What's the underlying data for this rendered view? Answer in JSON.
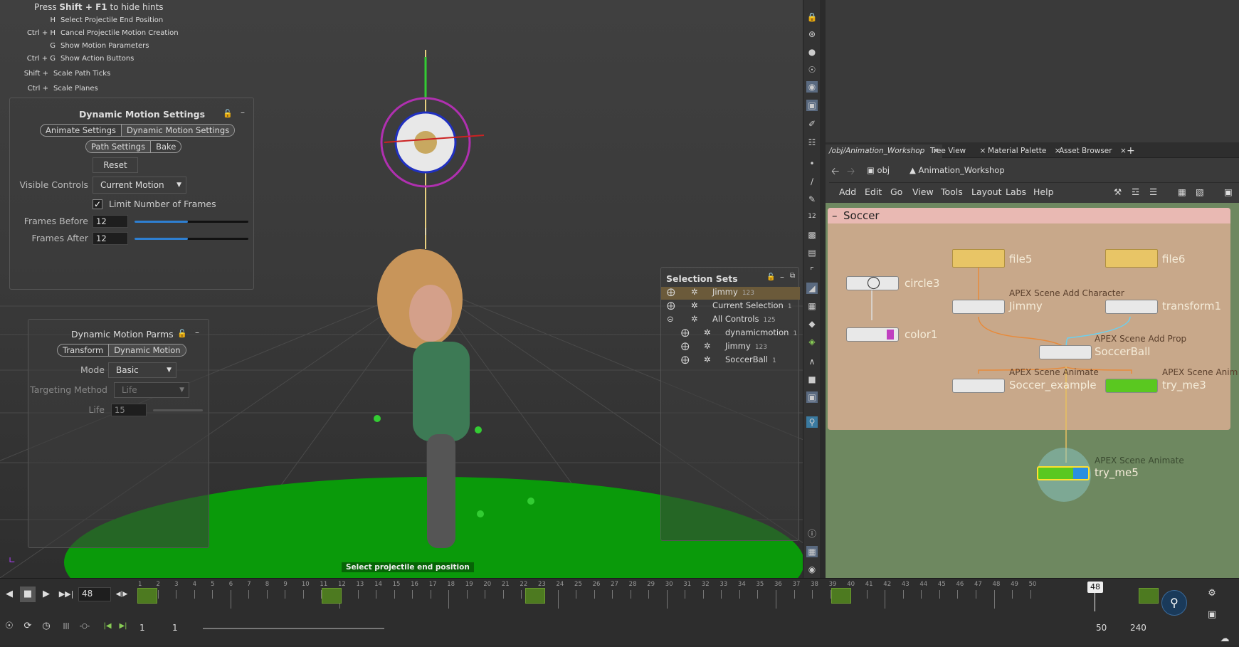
{
  "hints": {
    "header_prefix": "Press ",
    "header_key": "Shift + F1",
    "header_suffix": " to hide hints",
    "items": [
      {
        "key": "H",
        "text": "Select Projectile End Position"
      },
      {
        "key": "Ctrl + H",
        "text": "Cancel Projectile Motion Creation"
      },
      {
        "key": "G",
        "text": "Show Motion Parameters"
      },
      {
        "key": "Ctrl + G",
        "text": "Show Action Buttons"
      },
      {
        "key": "Shift +",
        "text": "Scale Path Ticks"
      },
      {
        "key": "Ctrl +",
        "text": "Scale Planes"
      }
    ]
  },
  "motion_settings": {
    "title": "Dynamic Motion Settings",
    "tab_animate": "Animate Settings",
    "tab_dynamic": "Dynamic Motion Settings",
    "tab_path": "Path Settings",
    "tab_bake": "Bake",
    "reset": "Reset",
    "visible_controls_label": "Visible Controls",
    "visible_controls_value": "Current Motion",
    "limit_label": "Limit Number of Frames",
    "frames_before_label": "Frames Before",
    "frames_before_value": "12",
    "frames_after_label": "Frames After",
    "frames_after_value": "12"
  },
  "motion_parms": {
    "title": "Dynamic Motion Parms",
    "tab_transform": "Transform",
    "tab_dynamic": "Dynamic Motion",
    "mode_label": "Mode",
    "mode_value": "Basic",
    "targeting_label": "Targeting Method",
    "targeting_value": "Life",
    "life_label": "Life",
    "life_value": "15"
  },
  "selection_sets": {
    "title": "Selection Sets",
    "rows": [
      {
        "label": "Jimmy",
        "count": "123"
      },
      {
        "label": "Current Selection",
        "count": "1"
      },
      {
        "label": "All Controls",
        "count": "125"
      },
      {
        "label": "dynamicmotion",
        "count": "1"
      },
      {
        "label": "Jimmy",
        "count": "123"
      },
      {
        "label": "SoccerBall",
        "count": "1"
      }
    ]
  },
  "status_message": "Select projectile end position",
  "tabs": [
    "/obj/Animation_Workshop",
    "Tree View",
    "Material Palette",
    "Asset Browser"
  ],
  "path": {
    "root": "obj",
    "current": "Animation_Workshop"
  },
  "menu": [
    "Add",
    "Edit",
    "Go",
    "View",
    "Tools",
    "Layout",
    "Labs",
    "Help"
  ],
  "network": {
    "box_title": "Soccer",
    "nodes": {
      "file5": "file5",
      "file6": "file6",
      "circle3": "circle3",
      "color1": "color1",
      "jimmy": "Jimmy",
      "jimmy_type": "APEX Scene Add Character",
      "transform1": "transform1",
      "soccerball": "SoccerBall",
      "soccerball_type": "APEX Scene Add Prop",
      "soccer_example": "Soccer_example",
      "soccer_example_type": "APEX Scene Animate",
      "try_me3": "try_me3",
      "try_me3_type": "APEX Scene Anim",
      "try_me5": "try_me5",
      "try_me5_type": "APEX Scene Animate"
    }
  },
  "timeline": {
    "current_frame": "48",
    "marker": "48",
    "start": "1",
    "start2": "1",
    "end_visible": "50",
    "end_total": "240",
    "ticks": [
      "1",
      "2",
      "3",
      "4",
      "5",
      "6",
      "7",
      "8",
      "9",
      "10",
      "11",
      "12",
      "13",
      "14",
      "15",
      "16",
      "17",
      "18",
      "19",
      "20",
      "21",
      "22",
      "23",
      "24",
      "25",
      "26",
      "27",
      "28",
      "29",
      "30",
      "31",
      "32",
      "33",
      "34",
      "35",
      "36",
      "37",
      "38",
      "39",
      "40",
      "41",
      "42",
      "43",
      "44",
      "45",
      "46",
      "47",
      "48",
      "49",
      "50"
    ]
  },
  "colors": {
    "accent": "#2e7fd1",
    "network_bg": "#6e8860",
    "box_bg": "#c8a88a",
    "box_header": "#e9b9b3",
    "key": "#4d7a20"
  }
}
